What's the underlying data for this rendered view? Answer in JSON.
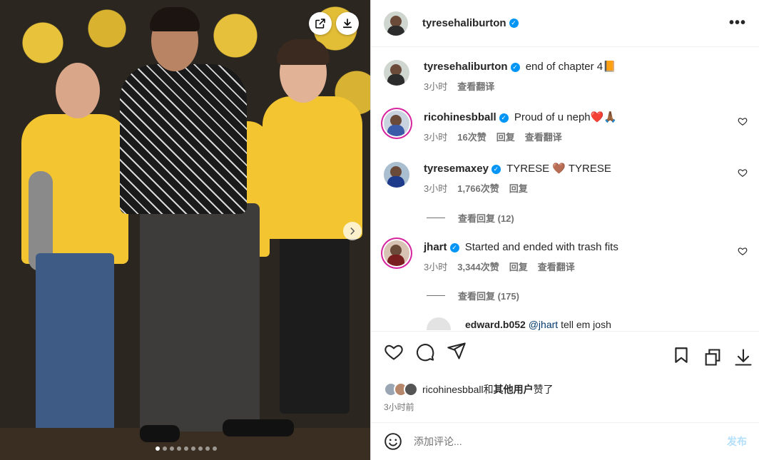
{
  "media": {
    "carousel_dots": 9,
    "active_dot": 0
  },
  "post": {
    "author": "tyresehaliburton",
    "caption": "end of chapter 4📙",
    "caption_time": "3小时",
    "caption_translate": "查看翻译"
  },
  "comments": [
    {
      "user": "ricohinesbball",
      "text": "Proud of u neph❤️🙏🏾",
      "time": "3小时",
      "likes": "16次赞",
      "reply": "回复",
      "translate": "查看翻译"
    },
    {
      "user": "tyresemaxey",
      "text": "TYRESE 🤎 TYRESE",
      "time": "3小时",
      "likes": "1,766次赞",
      "reply": "回复",
      "view_replies": "查看回复 (12)"
    },
    {
      "user": "jhart",
      "text": "Started and ended with trash fits",
      "time": "3小时",
      "likes": "3,344次赞",
      "reply": "回复",
      "translate": "查看翻译",
      "view_replies": "查看回复 (175)"
    },
    {
      "user": "edward.b052",
      "mention": "@jhart",
      "text": "tell em josh"
    }
  ],
  "likes_summary": {
    "user": "ricohinesbball",
    "and": "和",
    "others": "其他用户",
    "suffix": "赞了",
    "time": "3小时前"
  },
  "add_comment": {
    "placeholder": "添加评论...",
    "post_label": "发布"
  },
  "colors": {
    "verified": "#0095f6",
    "muted": "#737373",
    "post_disabled": "#b2dffc"
  }
}
